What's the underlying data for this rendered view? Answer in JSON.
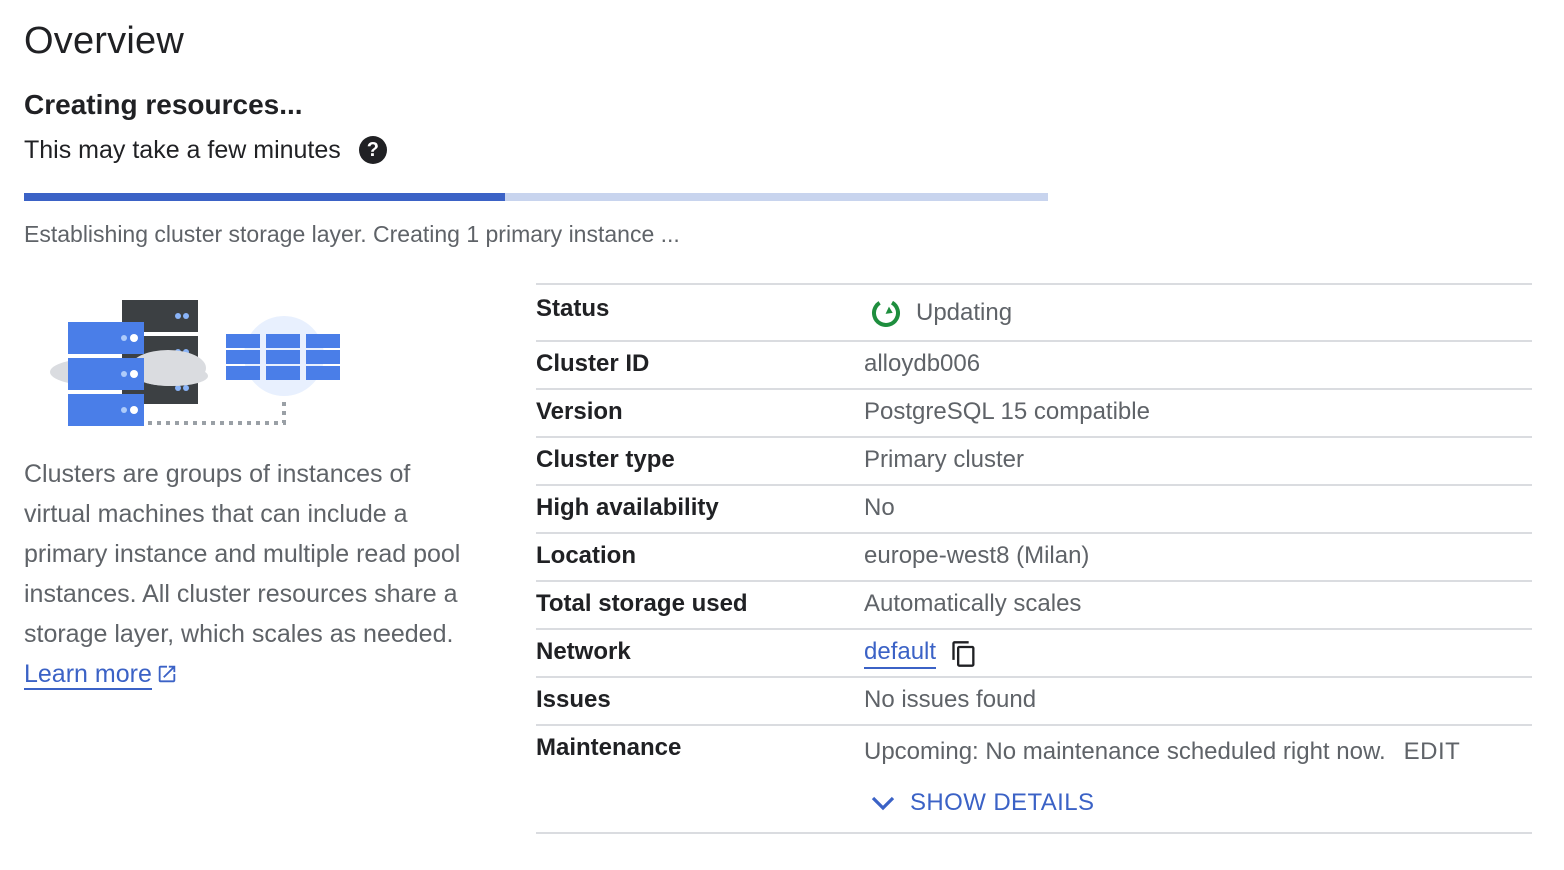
{
  "page": {
    "title": "Overview",
    "creating_title": "Creating resources...",
    "subtitle": "This may take a few minutes",
    "help_icon": "?",
    "progress_fraction": 0.47,
    "progress_text": "Establishing cluster storage layer. Creating 1 primary instance ..."
  },
  "description": {
    "text": "Clusters are groups of instances of virtual machines that can include a primary instance and multiple read pool instances. All cluster resources share a storage layer, which scales as needed. ",
    "learn_more": "Learn more"
  },
  "details": {
    "status_label": "Status",
    "status_value": "Updating",
    "cluster_id_label": "Cluster ID",
    "cluster_id_value": "alloydb006",
    "version_label": "Version",
    "version_value": "PostgreSQL 15 compatible",
    "cluster_type_label": "Cluster type",
    "cluster_type_value": "Primary cluster",
    "ha_label": "High availability",
    "ha_value": "No",
    "location_label": "Location",
    "location_value": "europe-west8 (Milan)",
    "storage_label": "Total storage used",
    "storage_value": "Automatically scales",
    "network_label": "Network",
    "network_value": "default",
    "issues_label": "Issues",
    "issues_value": "No issues found",
    "maintenance_label": "Maintenance",
    "maintenance_value": "Upcoming: No maintenance scheduled right now.",
    "edit_label": "EDIT",
    "show_details_label": "SHOW DETAILS"
  },
  "colors": {
    "accent": "#3b62c6",
    "progress_track": "#c8d4ee",
    "status_green": "#1e8e3e",
    "text_primary": "#202124",
    "text_secondary": "#5f6368"
  },
  "icons": {
    "help": "help-icon",
    "status": "refresh-circle-icon",
    "external": "external-link-icon",
    "copy": "copy-icon",
    "expand": "chevron-down-icon"
  }
}
